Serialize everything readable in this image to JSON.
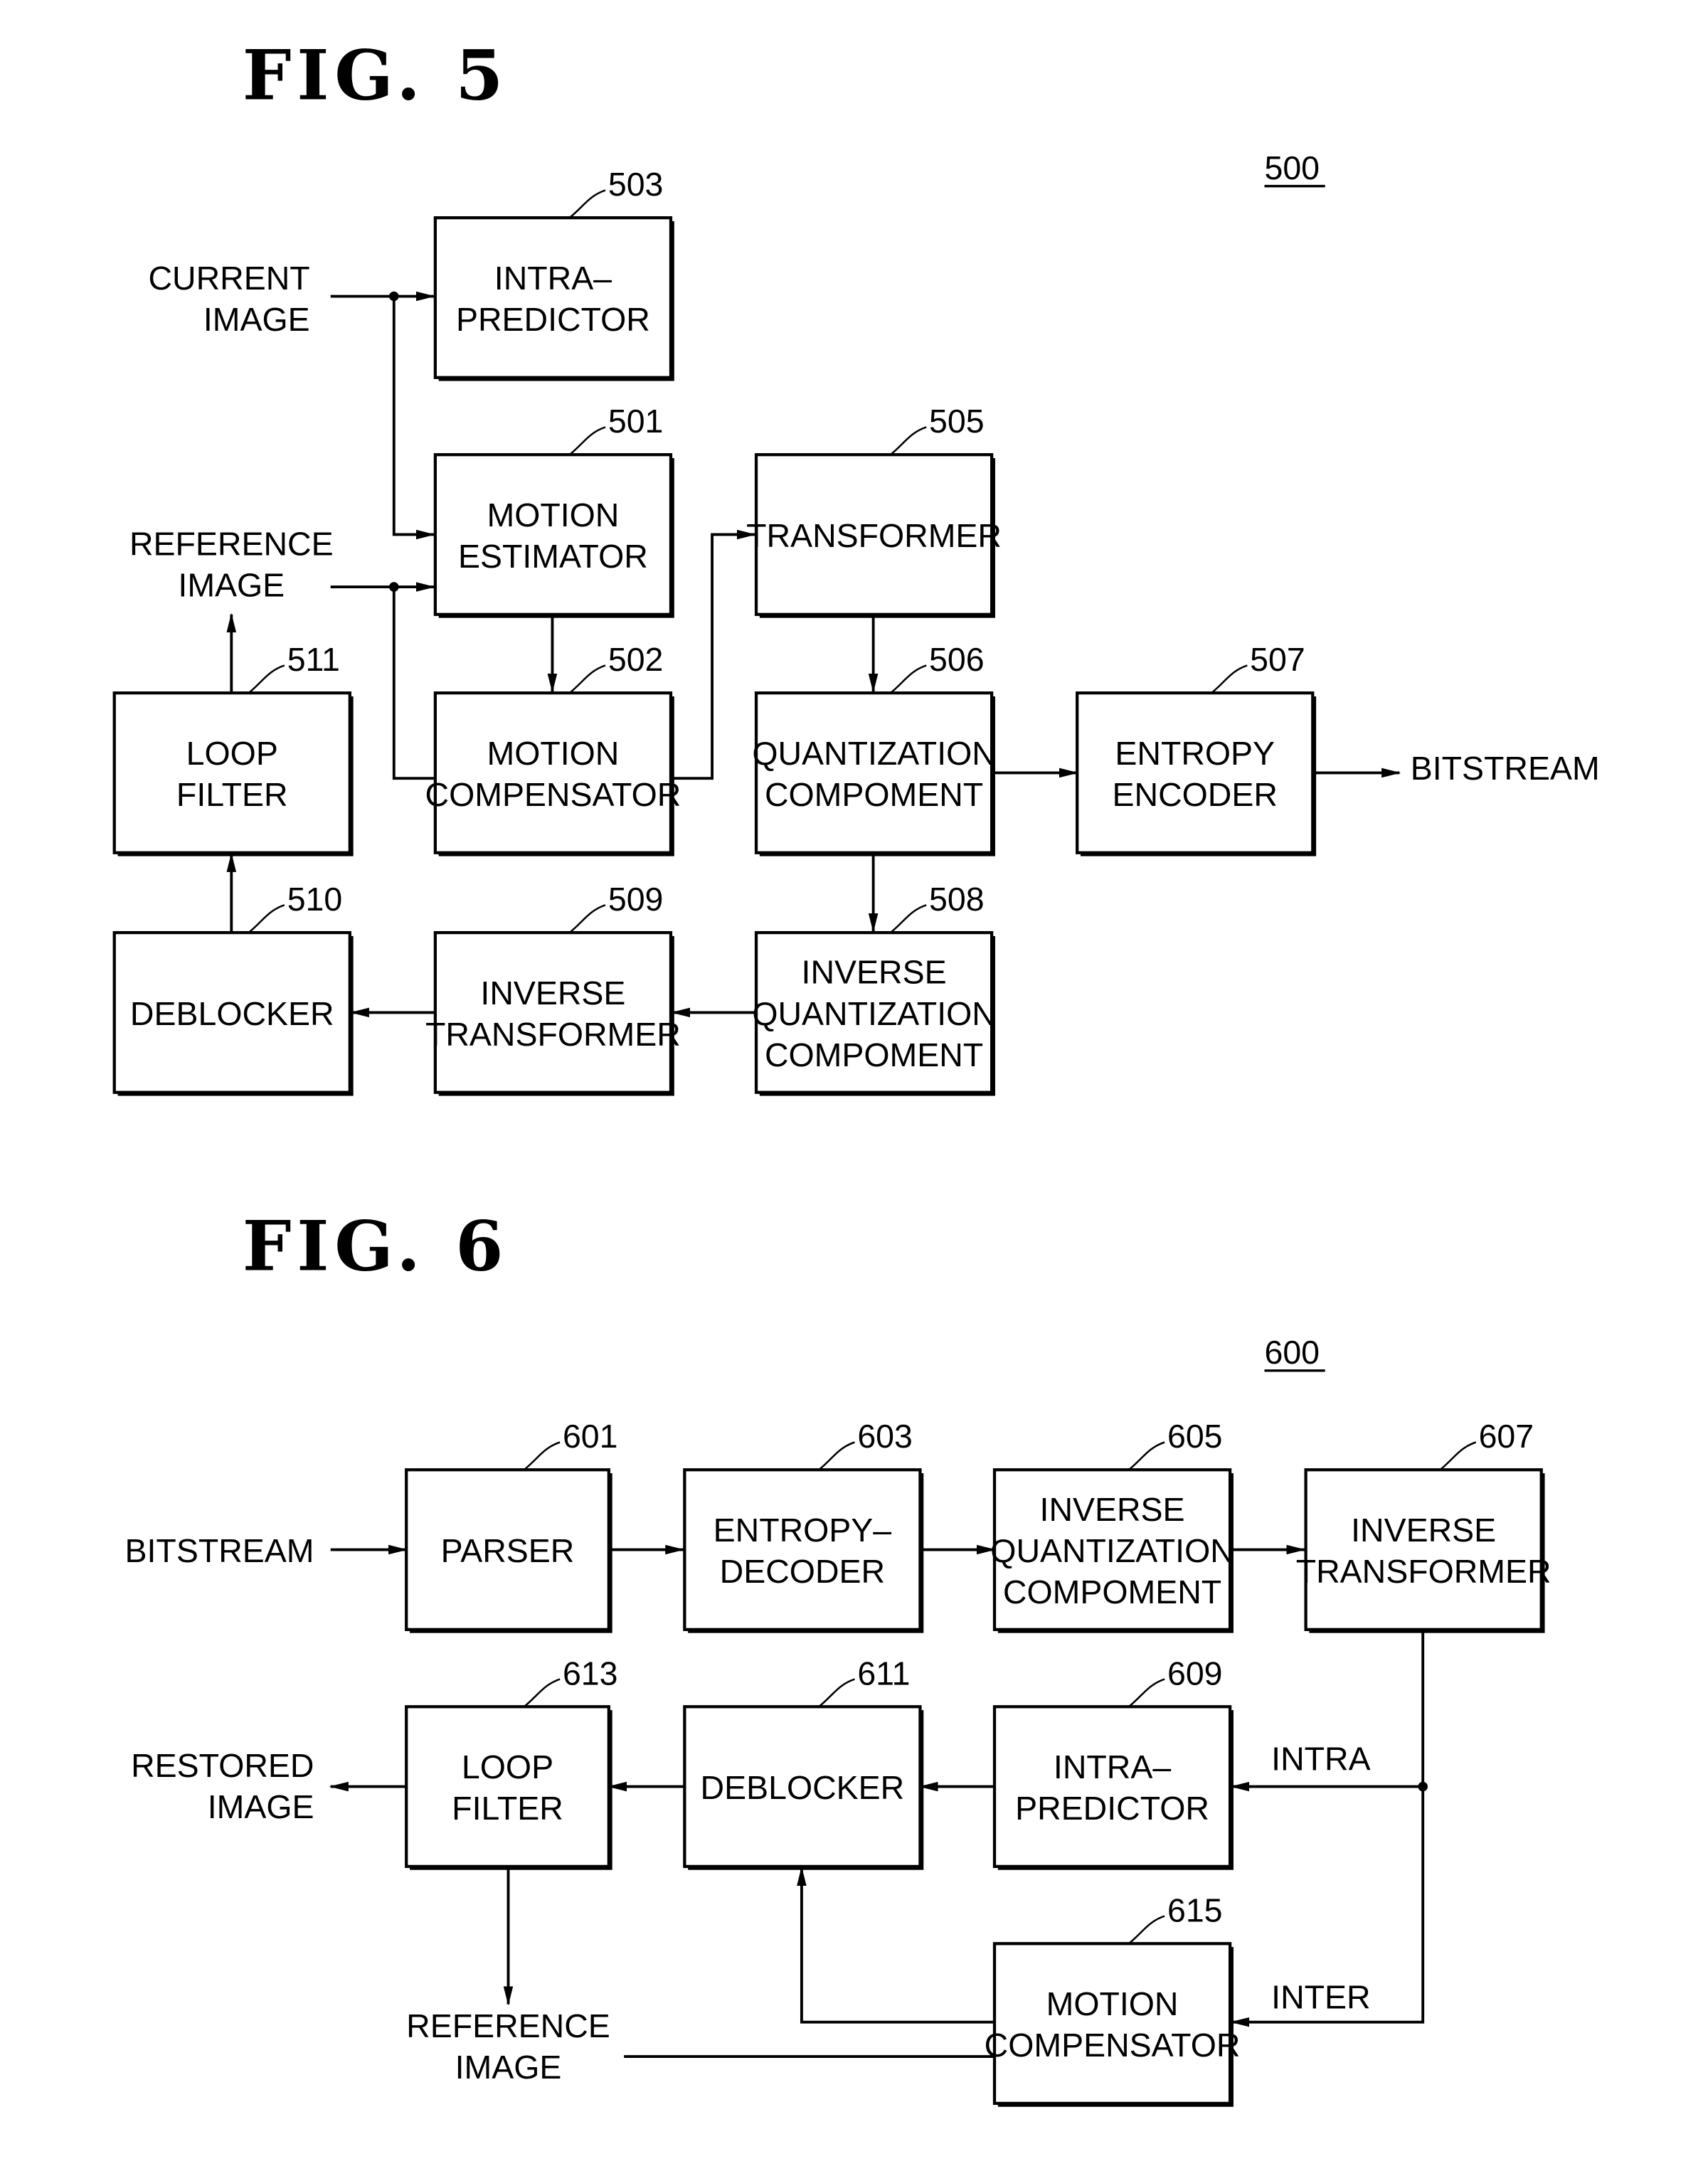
{
  "figures": [
    {
      "id": "fig5",
      "title": "FIG. 5",
      "ref": "500",
      "blocks": [
        {
          "id": "503",
          "lines": [
            "INTRA–",
            "PREDICTOR"
          ]
        },
        {
          "id": "501",
          "lines": [
            "MOTION",
            "ESTIMATOR"
          ]
        },
        {
          "id": "502",
          "lines": [
            "MOTION",
            "COMPENSATOR"
          ]
        },
        {
          "id": "505",
          "lines": [
            "TRANSFORMER"
          ]
        },
        {
          "id": "506",
          "lines": [
            "QUANTIZATION",
            "COMPOMENT"
          ]
        },
        {
          "id": "507",
          "lines": [
            "ENTROPY",
            "ENCODER"
          ]
        },
        {
          "id": "508",
          "lines": [
            "INVERSE",
            "QUANTIZATION",
            "COMPOMENT"
          ]
        },
        {
          "id": "509",
          "lines": [
            "INVERSE",
            "TRANSFORMER"
          ]
        },
        {
          "id": "510",
          "lines": [
            "DEBLOCKER"
          ]
        },
        {
          "id": "511",
          "lines": [
            "LOOP",
            "FILTER"
          ]
        }
      ],
      "io_labels": {
        "current_image": [
          "CURRENT",
          "IMAGE"
        ],
        "reference_image": [
          "REFERENCE",
          "IMAGE"
        ],
        "bitstream": [
          "BITSTREAM"
        ]
      }
    },
    {
      "id": "fig6",
      "title": "FIG. 6",
      "ref": "600",
      "blocks": [
        {
          "id": "601",
          "lines": [
            "PARSER"
          ]
        },
        {
          "id": "603",
          "lines": [
            "ENTROPY–",
            "DECODER"
          ]
        },
        {
          "id": "605",
          "lines": [
            "INVERSE",
            "QUANTIZATION",
            "COMPOMENT"
          ]
        },
        {
          "id": "607",
          "lines": [
            "INVERSE",
            "TRANSFORMER"
          ]
        },
        {
          "id": "609",
          "lines": [
            "INTRA–",
            "PREDICTOR"
          ]
        },
        {
          "id": "611",
          "lines": [
            "DEBLOCKER"
          ]
        },
        {
          "id": "613",
          "lines": [
            "LOOP",
            "FILTER"
          ]
        },
        {
          "id": "615",
          "lines": [
            "MOTION",
            "COMPENSATOR"
          ]
        }
      ],
      "io_labels": {
        "bitstream": [
          "BITSTREAM"
        ],
        "restored_image": [
          "RESTORED",
          "IMAGE"
        ],
        "reference_image": [
          "REFERENCE",
          "IMAGE"
        ],
        "intra": [
          "INTRA"
        ],
        "inter": [
          "INTER"
        ]
      }
    }
  ]
}
